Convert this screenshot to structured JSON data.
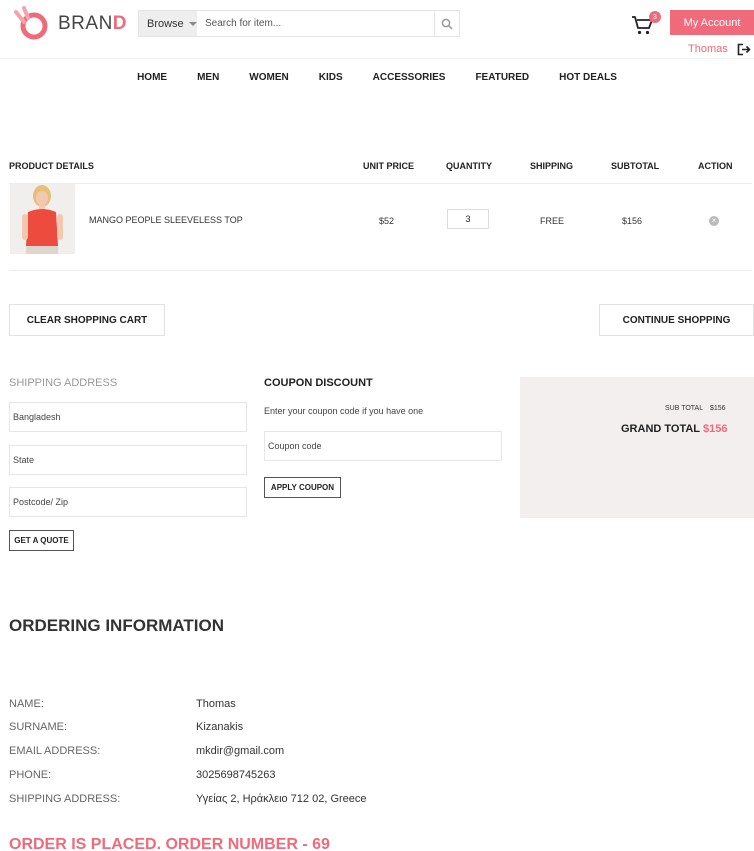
{
  "brand": {
    "name_main": "BRAN",
    "name_accent": "D"
  },
  "search": {
    "browse_label": "Browse",
    "placeholder": "Search for item..."
  },
  "cart": {
    "count": "3"
  },
  "account": {
    "button_label": "My Account",
    "user_name": "Thomas"
  },
  "nav": {
    "items": [
      "HOME",
      "MEN",
      "WOMEN",
      "KIDS",
      "ACCESSORIES",
      "FEATURED",
      "HOT DEALS"
    ]
  },
  "cart_table": {
    "headers": [
      "PRODUCT DETAILS",
      "UNIT PRICE",
      "QUANTITY",
      "SHIPPING",
      "SUBTOTAL",
      "ACTION"
    ],
    "rows": [
      {
        "product": "MANGO PEOPLE SLEEVELESS TOP",
        "unit_price": "$52",
        "quantity": "3",
        "shipping": "FREE",
        "subtotal": "$156"
      }
    ]
  },
  "actions": {
    "clear_label": "CLEAR SHOPPING CART",
    "continue_label": "CONTINUE SHOPPING"
  },
  "shipping": {
    "title": "SHIPPING ADDRESS",
    "country": "Bangladesh",
    "state": "State",
    "postcode": "Postcode/ Zip",
    "quote_label": "GET A QUOTE"
  },
  "coupon": {
    "title": "COUPON DISCOUNT",
    "description": "Enter your coupon code if you have one",
    "placeholder": "Coupon code",
    "apply_label": "APPLY COUPON"
  },
  "totals": {
    "subtotal_label": "SUB TOTAL",
    "subtotal_value": "$156",
    "grand_label": "GRAND TOTAL",
    "grand_value": "$156"
  },
  "ordering": {
    "title": "ORDERING INFORMATION",
    "fields": [
      {
        "label": "NAME:",
        "value": "Thomas"
      },
      {
        "label": "SURNAME:",
        "value": "Kizanakis"
      },
      {
        "label": "EMAIL ADDRESS:",
        "value": "mkdir@gmail.com"
      },
      {
        "label": "PHONE:",
        "value": "3025698745263"
      },
      {
        "label": "SHIPPING ADDRESS:",
        "value": "Υγείας 2, Ηράκλειο 712 02, Greece"
      }
    ],
    "status": "ORDER IS PLACED. ORDER NUMBER - 69"
  },
  "colors": {
    "accent": "#ef6a7a",
    "totals_bg": "#f4efef"
  }
}
